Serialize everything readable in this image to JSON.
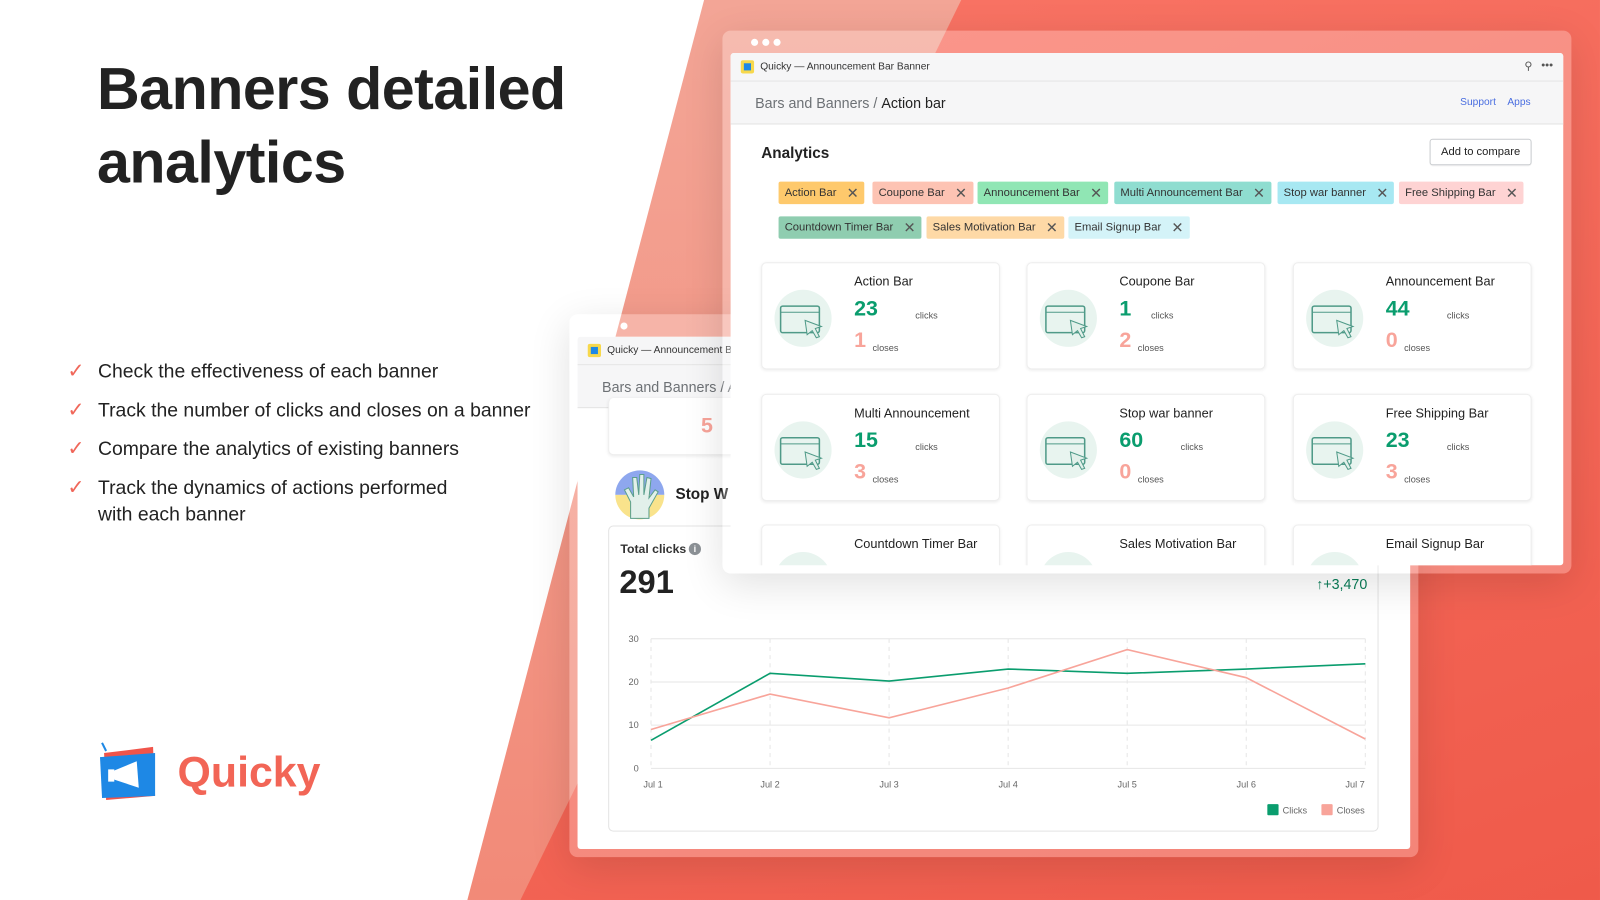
{
  "hero": {
    "title_line1": "Banners detailed",
    "title_line2": "analytics",
    "features": [
      "Check the effectiveness of each banner",
      "Track the number of clicks and closes on a banner",
      "Compare the analytics of existing banners",
      "Track the dynamics of actions performed",
      "with each banner"
    ],
    "brand": "Quicky"
  },
  "colors": {
    "accent": "#f26556",
    "clicks": "#0a9d6e",
    "closes": "#f8a49a",
    "link": "#4a6ee0"
  },
  "back_window": {
    "title": "Quicky — Announcement Ba",
    "breadcrumb": "Bars and Banners / A",
    "partial_closes": "5",
    "banner_name": "Stop W",
    "total_label": "Total clicks",
    "total_value": "291",
    "delta": "+3,470"
  },
  "front_window": {
    "title": "Quicky — Announcement Bar Banner",
    "breadcrumb_parent": "Bars and Banners",
    "breadcrumb_sep": " / ",
    "breadcrumb_current": "Action bar",
    "support": "Support",
    "apps": "Apps",
    "section": "Analytics",
    "add_compare": "Add to compare",
    "tags": [
      {
        "label": "Action Bar",
        "color": "#fec96c"
      },
      {
        "label": "Coupone Bar",
        "color": "#fdc3b3"
      },
      {
        "label": "Announcement Bar",
        "color": "#90e6b4"
      },
      {
        "label": "Multi Announcement Bar",
        "color": "#8fddd0"
      },
      {
        "label": "Stop war banner",
        "color": "#a7e8f2"
      },
      {
        "label": "Free Shipping Bar",
        "color": "#fed3d3"
      },
      {
        "label": "Countdown Timer Bar",
        "color": "#8fcdb0"
      },
      {
        "label": "Sales Motivation Bar",
        "color": "#fed9a6"
      },
      {
        "label": "Email Signup Bar",
        "color": "#d4f3f8"
      }
    ],
    "clicks_unit": "clicks",
    "closes_unit": "closes",
    "cards": [
      {
        "name": "Action Bar",
        "clicks": "23",
        "closes": "1",
        "icon": "browser-click-icon"
      },
      {
        "name": "Coupone Bar",
        "clicks": "1",
        "closes": "2",
        "icon": "coupon-scissors-icon"
      },
      {
        "name": "Announcement Bar",
        "clicks": "44",
        "closes": "0",
        "icon": "megaphone-icon"
      },
      {
        "name": "Multi Announcement",
        "clicks": "15",
        "closes": "3",
        "icon": "hand-megaphone-icon"
      },
      {
        "name": "Stop war banner",
        "clicks": "60",
        "closes": "0",
        "icon": "stop-hand-icon"
      },
      {
        "name": "Free Shipping Bar",
        "clicks": "23",
        "closes": "3",
        "icon": "delivery-icon"
      },
      {
        "name": "Countdown Timer Bar",
        "icon": "timer-browser-icon"
      },
      {
        "name": "Sales Motivation Bar",
        "icon": "sales-icon"
      },
      {
        "name": "Email Signup Bar",
        "icon": "paper-plane-icon"
      }
    ]
  },
  "chart_data": {
    "type": "line",
    "x": [
      "Jul 1",
      "Jul 2",
      "Jul 3",
      "Jul 4",
      "Jul 5",
      "Jul 6",
      "Jul 7"
    ],
    "ylim": [
      0,
      30
    ],
    "yticks": [
      0,
      10,
      20,
      30
    ],
    "grid": true,
    "legend": "bottom-right",
    "series": [
      {
        "name": "Clicks",
        "color": "#0a9d6e",
        "values": [
          6.5,
          22,
          20.2,
          23,
          22,
          23,
          24.2
        ]
      },
      {
        "name": "Closes",
        "color": "#f8a49a",
        "values": [
          9,
          17.2,
          11.7,
          18.6,
          27.5,
          21,
          6.8
        ]
      }
    ]
  }
}
